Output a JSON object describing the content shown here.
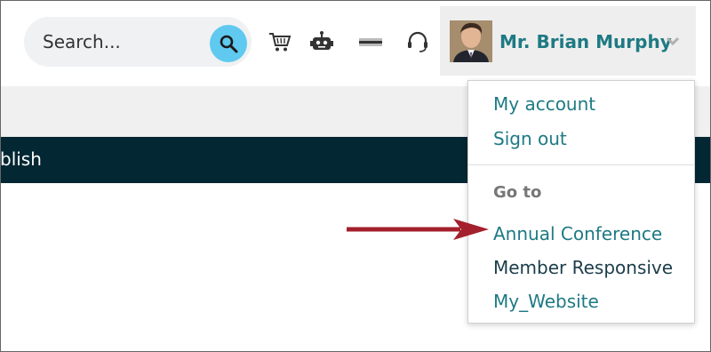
{
  "search": {
    "placeholder": "Search..."
  },
  "toolbar": {
    "icons": [
      "cart-icon",
      "robot-icon",
      "card-icon",
      "headset-icon"
    ]
  },
  "user": {
    "name": "Mr. Brian Murphy"
  },
  "page": {
    "dark_bar_text": "blish"
  },
  "dropdown": {
    "items": [
      "My account",
      "Sign out"
    ],
    "goto_heading": "Go to",
    "goto_items": [
      "Annual Conference",
      "Member Responsive",
      "My_Website"
    ]
  },
  "colors": {
    "accent": "#1e7a83",
    "search_button": "#5fc9ef",
    "dark_bar": "#032733",
    "arrow": "#a3202c"
  }
}
